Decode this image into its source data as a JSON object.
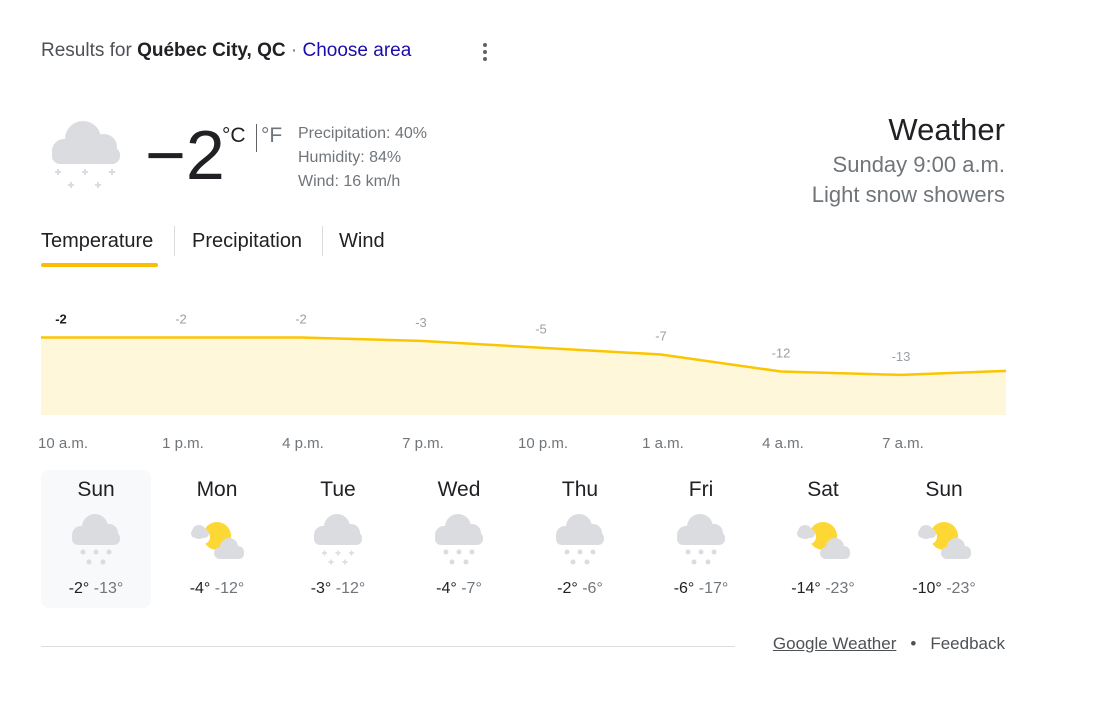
{
  "header": {
    "results_prefix": "Results for",
    "location": "Québec City, QC",
    "separator": "·",
    "choose_area": "Choose area"
  },
  "current": {
    "icon": "snow-cloud-icon",
    "temperature": "−2",
    "unit_c": "°C",
    "unit_f": "°F",
    "precipitation": "Precipitation: 40%",
    "humidity": "Humidity: 84%",
    "wind": "Wind: 16 km/h",
    "title": "Weather",
    "time": "Sunday 9:00 a.m.",
    "condition": "Light snow showers"
  },
  "tabs": [
    {
      "label": "Temperature",
      "active": true
    },
    {
      "label": "Precipitation",
      "active": false
    },
    {
      "label": "Wind",
      "active": false
    }
  ],
  "chart_data": {
    "type": "area",
    "x": [
      "10 a.m.",
      "1 p.m.",
      "4 p.m.",
      "7 p.m.",
      "10 p.m.",
      "1 a.m.",
      "4 a.m.",
      "7 a.m."
    ],
    "labels": [
      "-2",
      "-2",
      "-2",
      "-3",
      "-5",
      "-7",
      "-12",
      "-13"
    ],
    "values": [
      -2,
      -2,
      -2,
      -3,
      -5,
      -7,
      -12,
      -13
    ],
    "fill_color": "#fef7d9",
    "line_color": "#fbc500"
  },
  "days": [
    {
      "name": "Sun",
      "icon": "snow-cloud-icon",
      "hi": "-2°",
      "lo": "-13°",
      "selected": true
    },
    {
      "name": "Mon",
      "icon": "partly-cloudy-icon",
      "hi": "-4°",
      "lo": "-12°",
      "selected": false
    },
    {
      "name": "Tue",
      "icon": "snow-cloud-icon",
      "hi": "-3°",
      "lo": "-12°",
      "selected": false
    },
    {
      "name": "Wed",
      "icon": "snow-cloud-icon",
      "hi": "-4°",
      "lo": "-7°",
      "selected": false
    },
    {
      "name": "Thu",
      "icon": "snow-cloud-icon",
      "hi": "-2°",
      "lo": "-6°",
      "selected": false
    },
    {
      "name": "Fri",
      "icon": "snow-cloud-icon",
      "hi": "-6°",
      "lo": "-17°",
      "selected": false
    },
    {
      "name": "Sat",
      "icon": "partly-cloudy-icon",
      "hi": "-14°",
      "lo": "-23°",
      "selected": false
    },
    {
      "name": "Sun",
      "icon": "partly-cloudy-icon",
      "hi": "-10°",
      "lo": "-23°",
      "selected": false
    }
  ],
  "footer": {
    "source": "Google Weather",
    "bullet": "•",
    "feedback": "Feedback"
  },
  "colors": {
    "accent": "#fbbc04",
    "link": "#1a0dab",
    "selected_day_bg": "#f8f9fa"
  }
}
